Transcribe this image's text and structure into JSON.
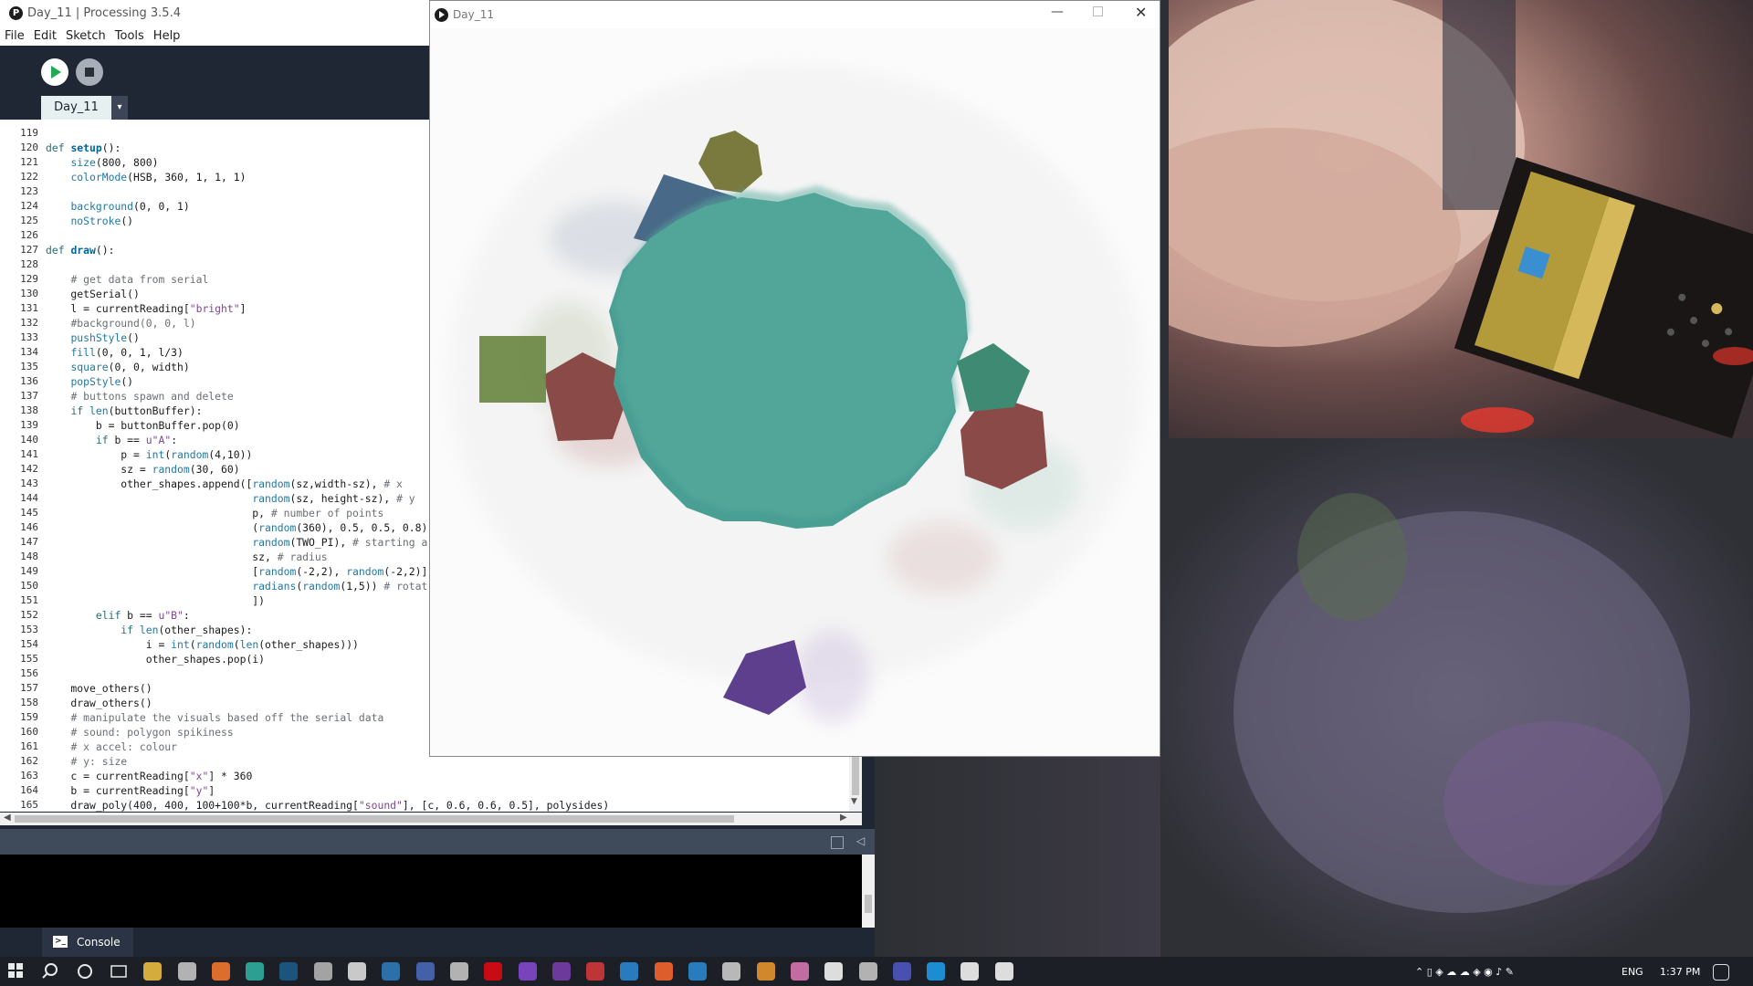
{
  "ide": {
    "title": "Day_11 | Processing 3.5.4",
    "menu": [
      "File",
      "Edit",
      "Sketch",
      "Tools",
      "Help"
    ],
    "tab_label": "Day_11",
    "tab_menu_icon": "▾",
    "console_label": "Console"
  },
  "code": {
    "lines": [
      {
        "n": "119",
        "t": ""
      },
      {
        "n": "120",
        "t": "def setup():"
      },
      {
        "n": "121",
        "t": "    size(800, 800)"
      },
      {
        "n": "122",
        "t": "    colorMode(HSB, 360, 1, 1, 1)"
      },
      {
        "n": "123",
        "t": ""
      },
      {
        "n": "124",
        "t": "    background(0, 0, 1)"
      },
      {
        "n": "125",
        "t": "    noStroke()"
      },
      {
        "n": "126",
        "t": ""
      },
      {
        "n": "127",
        "t": "def draw():"
      },
      {
        "n": "128",
        "t": ""
      },
      {
        "n": "129",
        "t": "    # get data from serial"
      },
      {
        "n": "130",
        "t": "    getSerial()"
      },
      {
        "n": "131",
        "t": "    l = currentReading[\"bright\"]"
      },
      {
        "n": "132",
        "t": "    #background(0, 0, l)"
      },
      {
        "n": "133",
        "t": "    pushStyle()"
      },
      {
        "n": "134",
        "t": "    fill(0, 0, 1, l/3)"
      },
      {
        "n": "135",
        "t": "    square(0, 0, width)"
      },
      {
        "n": "136",
        "t": "    popStyle()"
      },
      {
        "n": "137",
        "t": "    # buttons spawn and delete"
      },
      {
        "n": "138",
        "t": "    if len(buttonBuffer):"
      },
      {
        "n": "139",
        "t": "        b = buttonBuffer.pop(0)"
      },
      {
        "n": "140",
        "t": "        if b == u\"A\":"
      },
      {
        "n": "141",
        "t": "            p = int(random(4,10))"
      },
      {
        "n": "142",
        "t": "            sz = random(30, 60)"
      },
      {
        "n": "143",
        "t": "            other_shapes.append([random(sz,width-sz), # x"
      },
      {
        "n": "144",
        "t": "                                 random(sz, height-sz), # y"
      },
      {
        "n": "145",
        "t": "                                 p, # number of points"
      },
      {
        "n": "146",
        "t": "                                 (random(360), 0.5, 0.5, 0.8)"
      },
      {
        "n": "147",
        "t": "                                 random(TWO_PI), # starting a"
      },
      {
        "n": "148",
        "t": "                                 sz, # radius"
      },
      {
        "n": "149",
        "t": "                                 [random(-2,2), random(-2,2)]"
      },
      {
        "n": "150",
        "t": "                                 radians(random(1,5)) # rotat"
      },
      {
        "n": "151",
        "t": "                                 ])"
      },
      {
        "n": "152",
        "t": "        elif b == u\"B\":"
      },
      {
        "n": "153",
        "t": "            if len(other_shapes):"
      },
      {
        "n": "154",
        "t": "                i = int(random(len(other_shapes)))"
      },
      {
        "n": "155",
        "t": "                other_shapes.pop(i)"
      },
      {
        "n": "156",
        "t": ""
      },
      {
        "n": "157",
        "t": "    move_others()"
      },
      {
        "n": "158",
        "t": "    draw_others()"
      },
      {
        "n": "159",
        "t": "    # manipulate the visuals based off the serial data"
      },
      {
        "n": "160",
        "t": "    # sound: polygon spikiness"
      },
      {
        "n": "161",
        "t": "    # x accel: colour"
      },
      {
        "n": "162",
        "t": "    # y: size"
      },
      {
        "n": "163",
        "t": "    c = currentReading[\"x\"] * 360"
      },
      {
        "n": "164",
        "t": "    b = currentReading[\"y\"]"
      },
      {
        "n": "165",
        "t": "    draw_poly(400, 400, 100+100*b, currentReading[\"sound\"], [c, 0.6, 0.6, 0.5], polysides)"
      }
    ]
  },
  "sketch_window": {
    "title": "Day_11",
    "minimize": "—",
    "close": "✕"
  },
  "colors": {
    "teal": "#4a9f94",
    "olive": "#7a7a3e",
    "steel_blue": "#486a88",
    "green": "#6e8a48",
    "maroon": "#8a4a48",
    "purple": "#5e3f8e",
    "green_teal": "#3f8a72"
  },
  "taskbar": {
    "language": "ENG",
    "time": "1:37 PM",
    "icons": [
      "windows-start-icon",
      "search-icon",
      "cortana-icon",
      "task-view-icon",
      "file-explorer-icon",
      "store-icon",
      "firefox-icon",
      "edge-icon",
      "steam-icon",
      "calculator-icon",
      "chrome-icon",
      "edge-legacy-icon",
      "package-icon",
      "tool-icon",
      "netflix-icon",
      "twitch-icon",
      "onenote-icon",
      "app-red-icon",
      "paint-icon",
      "app-orange-icon",
      "app-blue-icon",
      "app-cloud-icon",
      "blender-icon",
      "app-pink-icon",
      "processing-icon",
      "app-steam2-icon",
      "teams-icon",
      "twitter-icon",
      "processing-running-icon",
      "arrow-icon"
    ]
  }
}
